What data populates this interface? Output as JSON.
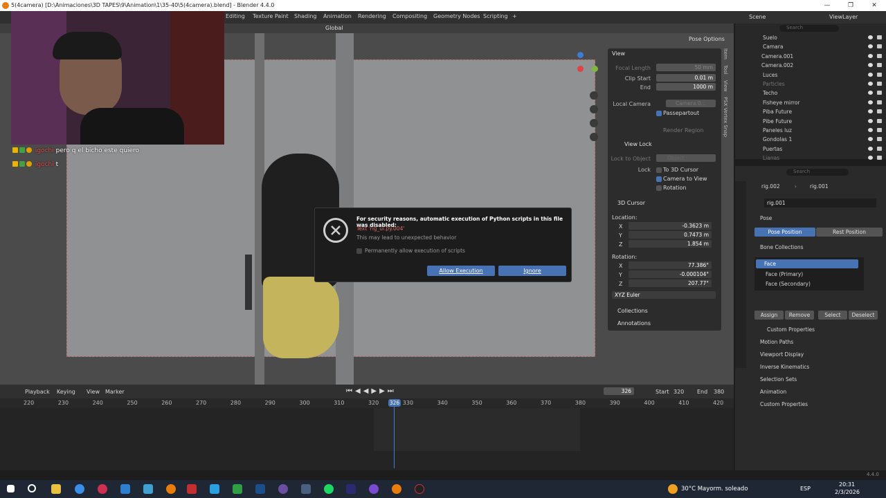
{
  "window": {
    "title": "5(4camera) [D:\\Animaciones\\3D TAPES\\9\\Animation\\1\\35-40\\5(4camera).blend] - Blender 4.4.0",
    "controls": [
      "—",
      "❐",
      "✕"
    ]
  },
  "workspaces": [
    "Editing",
    "Texture Paint",
    "Shading",
    "Animation",
    "Rendering",
    "Compositing",
    "Geometry Nodes",
    "Scripting",
    "+"
  ],
  "topright": {
    "scene": "Scene",
    "viewlayer": "ViewLayer"
  },
  "viewport_header": {
    "orientation": "Global",
    "pose_options": "Pose Options"
  },
  "npanel": {
    "tabs": [
      "Item",
      "Tool",
      "View",
      "PSX Vertex Snap"
    ],
    "view_header": "View",
    "focal_length_label": "Focal Length",
    "focal_length": "50 mm",
    "clip_start_label": "Clip Start",
    "clip_start": "0.01 m",
    "end_label": "End",
    "end": "1000 m",
    "local_camera_label": "Local Camera",
    "local_camera": "Camera.0...",
    "passepartout": "Passepartout",
    "render_region": "Render Region",
    "view_lock_header": "View Lock",
    "lock_to_object_label": "Lock to Object",
    "lock_to_object": "Object",
    "lock_label": "Lock",
    "to_3d_cursor": "To 3D Cursor",
    "camera_to_view": "Camera to View",
    "rotation_chk": "Rotation",
    "cursor_header": "3D Cursor",
    "location_label": "Location:",
    "loc_x": "-0.3623 m",
    "loc_y": "0.7473 m",
    "loc_z": "1.854 m",
    "rotation_label": "Rotation:",
    "rot_x": "77.386°",
    "rot_y": "-0.000104°",
    "rot_z": "207.77°",
    "euler": "XYZ Euler",
    "collections": "Collections",
    "annotations": "Annotations",
    "x": "X",
    "y": "Y",
    "z": "Z"
  },
  "dialog": {
    "title": "For security reasons, automatic execution of Python scripts in this file was disabled:",
    "text_ref": "Text 'rig_ui.py.004'",
    "warning": "This may lead to unexpected behavior",
    "checkbox": "Permanently allow execution of scripts",
    "allow": "Allow Execution",
    "ignore": "Ignore"
  },
  "chat": [
    {
      "user": "igochi",
      "message": "pero q el bicho este quiero"
    },
    {
      "user": "igochi",
      "message": "t"
    }
  ],
  "timeline": {
    "menus": [
      "Playback",
      "Keying",
      "View",
      "Marker"
    ],
    "current_frame": "326",
    "start_label": "Start",
    "start": "320",
    "end_label": "End",
    "end": "380",
    "ticks": [
      "220",
      "230",
      "240",
      "250",
      "260",
      "270",
      "280",
      "290",
      "300",
      "310",
      "320",
      "330",
      "340",
      "350",
      "360",
      "370",
      "380",
      "390",
      "400",
      "410",
      "420"
    ],
    "playhead_label": "326"
  },
  "outliner": {
    "search_placeholder": "Search",
    "items": [
      {
        "name": "Suelo",
        "dim": false
      },
      {
        "name": "Camara",
        "dim": false
      },
      {
        "name": "Camera.001",
        "dim": false
      },
      {
        "name": "Camera.002",
        "dim": false
      },
      {
        "name": "Luces",
        "dim": false
      },
      {
        "name": "Particles",
        "dim": true
      },
      {
        "name": "Techo",
        "dim": false
      },
      {
        "name": "Fisheye mirror",
        "dim": false
      },
      {
        "name": "Piba Future",
        "dim": false
      },
      {
        "name": "Pibe Future",
        "dim": false
      },
      {
        "name": "Paneles luz",
        "dim": false
      },
      {
        "name": "Gondolas 1",
        "dim": false
      },
      {
        "name": "Puertas",
        "dim": false
      },
      {
        "name": "Lianas",
        "dim": true
      }
    ]
  },
  "properties": {
    "search_placeholder": "Search",
    "breadcrumb_a": "rig.002",
    "breadcrumb_b": "rig.001",
    "object_name": "rig.001",
    "pose": "Pose",
    "pose_position": "Pose Position",
    "rest_position": "Rest Position",
    "bone_collections": "Bone Collections",
    "collections": [
      "Face",
      "Face (Primary)",
      "Face (Secondary)"
    ],
    "assign": "Assign",
    "remove": "Remove",
    "select": "Select",
    "deselect": "Deselect",
    "custom_properties_sub": "Custom Properties",
    "sections": [
      "Motion Paths",
      "Viewport Display",
      "Inverse Kinematics",
      "Selection Sets",
      "Animation",
      "Custom Properties"
    ]
  },
  "taskbar": {
    "weather": "30°C  Mayorm. soleado",
    "lang": "ESP",
    "time": "20:31",
    "date": "2/3/2026"
  },
  "version": "4.4.0"
}
